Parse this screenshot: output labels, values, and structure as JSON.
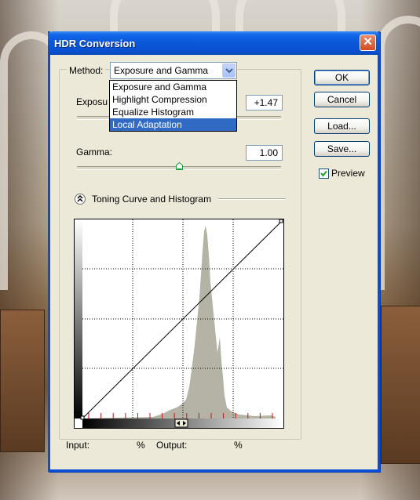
{
  "dialog": {
    "title": "HDR Conversion",
    "close_glyph": "✕"
  },
  "method": {
    "label": "Method:",
    "selected": "Exposure and Gamma",
    "options": [
      "Exposure and Gamma",
      "Highlight Compression",
      "Equalize Histogram",
      "Local Adaptation"
    ],
    "highlighted_index": 3
  },
  "exposure": {
    "label": "Exposure:",
    "label_visible": "Exposu",
    "value": "+1.47"
  },
  "gamma": {
    "label": "Gamma:",
    "value": "1.00",
    "slider_level": 0.5
  },
  "toning": {
    "label": "Toning Curve and Histogram",
    "toggle_icon": "chevron-up-icon"
  },
  "buttons": {
    "ok": "OK",
    "cancel": "Cancel",
    "load": "Load...",
    "save": "Save..."
  },
  "preview": {
    "label": "Preview",
    "checked": true
  },
  "readout": {
    "input_label": "Input:",
    "input_unit": "%",
    "output_label": "Output:",
    "output_unit": "%"
  },
  "colors": {
    "titlebar": "#0a58d8",
    "selection": "#316ac5",
    "histogram": "#b5b2a6",
    "dialog_bg": "#ece9d8"
  }
}
